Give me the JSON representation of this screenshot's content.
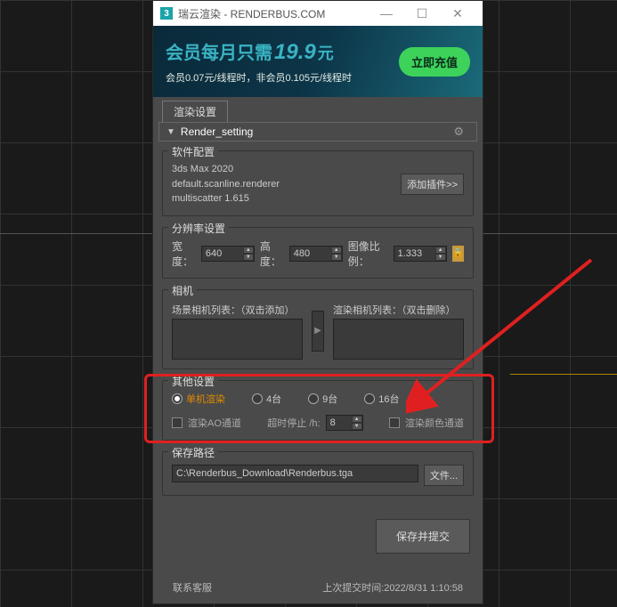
{
  "titlebar": {
    "icon": "3",
    "title": "瑞云渲染 - RENDERBUS.COM"
  },
  "banner": {
    "t1": "会员每月只需",
    "t2": "19.9",
    "t3": "元",
    "sub": "会员0.07元/线程时，非会员0.105元/线程时",
    "recharge": "立即充值"
  },
  "tabs": {
    "render_settings": "渲染设置"
  },
  "panel": {
    "title": "Render_setting"
  },
  "software": {
    "title": "软件配置",
    "lines": [
      "3ds Max 2020",
      "default.scanline.renderer",
      "multiscatter 1.615"
    ],
    "add_plugin": "添加插件>>"
  },
  "resolution": {
    "title": "分辨率设置",
    "width_label": "宽度：",
    "width": "640",
    "height_label": "高度：",
    "height": "480",
    "ratio_label": "图像比例：",
    "ratio": "1.333"
  },
  "camera": {
    "title": "相机",
    "scene_label": "场景相机列表：（双击添加）",
    "render_label": "渲染相机列表：（双击删除）"
  },
  "other": {
    "title": "其他设置",
    "r_single": "单机渲染",
    "r_4": "4台",
    "r_9": "9台",
    "r_16": "16台",
    "ao_label": "渲染AO通道",
    "timeout_label": "超时停止 /h:",
    "timeout": "8",
    "color_label": "渲染颜色通道"
  },
  "save": {
    "title": "保存路径",
    "path": "C:\\Renderbus_Download\\Renderbus.tga",
    "file_btn": "文件..."
  },
  "submit": "保存并提交",
  "footer": {
    "contact": "联系客服",
    "last_submit": "上次提交时间:2022/8/31  1:10:58"
  }
}
